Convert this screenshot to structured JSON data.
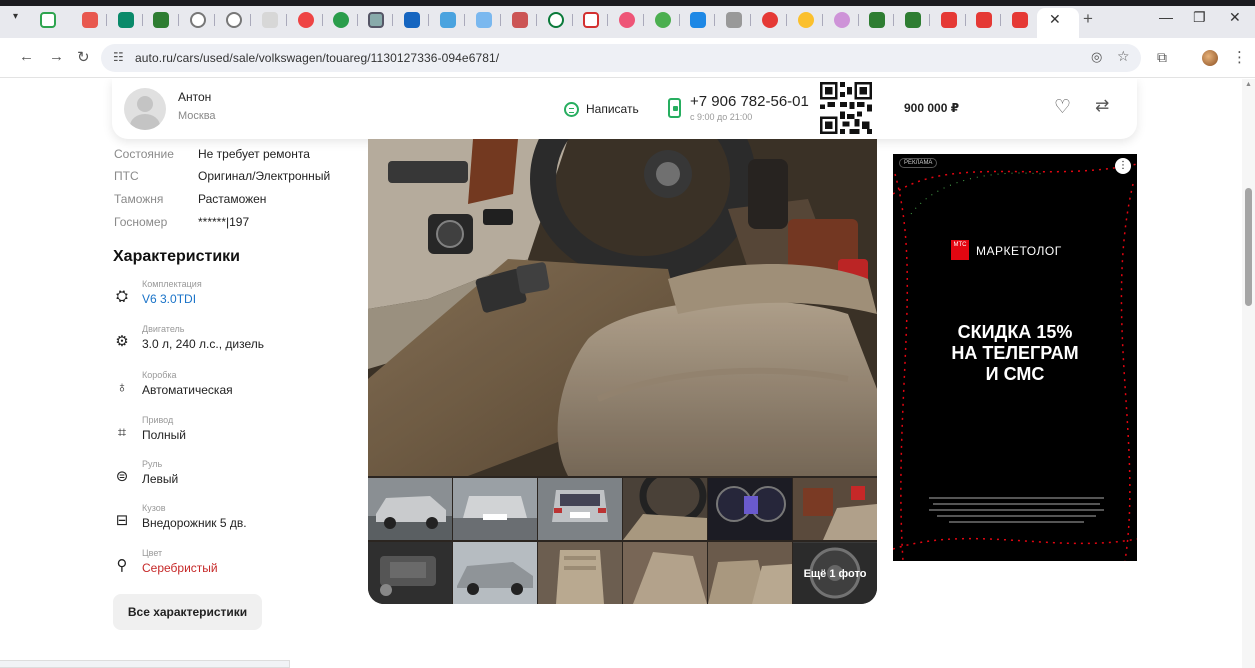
{
  "browser": {
    "url": "auto.ru/cars/used/sale/volkswagen/touareg/1130127336-094e6781/",
    "colors": {
      "tab_strip": "#e8e9ee",
      "omnibox": "#eef0f5"
    }
  },
  "seller": {
    "name": "Антон",
    "city": "Москва",
    "write_label": "Написать",
    "phone": "+7 906 782-56-01",
    "phone_hours": "с 9:00 до 21:00",
    "price": "900 000 ₽"
  },
  "specs": [
    {
      "key": "Состояние",
      "value": "Не требует ремонта"
    },
    {
      "key": "ПТС",
      "value": "Оригинал/Электронный"
    },
    {
      "key": "Таможня",
      "value": "Растаможен"
    },
    {
      "key": "Госномер",
      "value": "******|197"
    }
  ],
  "characteristics": {
    "title": "Характеристики",
    "items": [
      {
        "label": "Комплектация",
        "value": "V6 3.0TDI",
        "icon": "trim-icon"
      },
      {
        "label": "Двигатель",
        "value": "3.0 л, 240 л.с., дизель",
        "icon": "engine-icon"
      },
      {
        "label": "Коробка",
        "value": "Автоматическая",
        "icon": "gearbox-icon"
      },
      {
        "label": "Привод",
        "value": "Полный",
        "icon": "drive-icon"
      },
      {
        "label": "Руль",
        "value": "Левый",
        "icon": "steering-wheel-icon"
      },
      {
        "label": "Кузов",
        "value": "Внедорожник 5 дв.",
        "icon": "car-body-icon"
      },
      {
        "label": "Цвет",
        "value": "Серебристый",
        "icon": "color-icon"
      }
    ],
    "all_button": "Все характеристики"
  },
  "gallery": {
    "more_label": "Ещё 1 фото"
  },
  "ad": {
    "tag": "РЕКЛАМА",
    "brand_mark": "МТС",
    "brand": "МАРКЕТОЛОГ",
    "headline": [
      "СКИДКА 15%",
      "НА ТЕЛЕГРАМ",
      "И СМС"
    ],
    "accent_color": "#e30611"
  }
}
